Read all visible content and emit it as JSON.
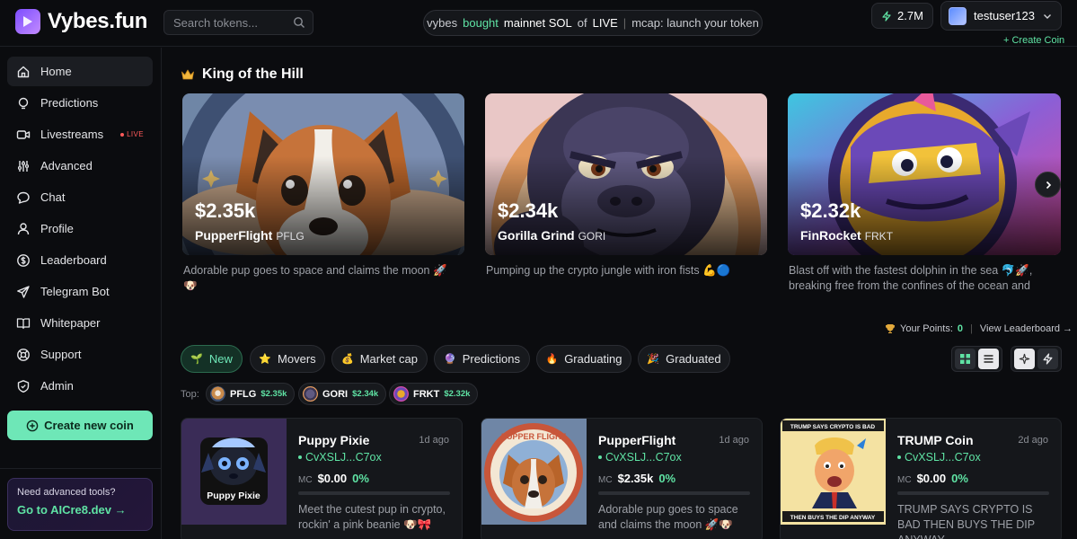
{
  "app": {
    "name": "Vybes.fun"
  },
  "search": {
    "placeholder": "Search tokens..."
  },
  "ticker": {
    "user": "vybes",
    "action": "bought",
    "network": "mainnet SOL",
    "of": "of",
    "status": "LIVE",
    "sep": "|",
    "mcap": "mcap: launch your token"
  },
  "header": {
    "points": "2.7M",
    "username": "testuser123",
    "create_link": "+ Create Coin"
  },
  "sidebar": {
    "items": [
      {
        "label": "Home",
        "icon": "home-icon",
        "active": true
      },
      {
        "label": "Predictions",
        "icon": "lightbulb-icon"
      },
      {
        "label": "Livestreams",
        "icon": "video-icon",
        "badge": "LIVE"
      },
      {
        "label": "Advanced",
        "icon": "sliders-icon"
      },
      {
        "label": "Chat",
        "icon": "chat-icon"
      },
      {
        "label": "Profile",
        "icon": "user-icon"
      },
      {
        "label": "Leaderboard",
        "icon": "dollar-circle-icon"
      },
      {
        "label": "Telegram Bot",
        "icon": "send-icon"
      },
      {
        "label": "Whitepaper",
        "icon": "book-icon"
      },
      {
        "label": "Support",
        "icon": "lifebuoy-icon"
      },
      {
        "label": "Admin",
        "icon": "shield-icon"
      }
    ],
    "create_button": "Create new coin",
    "promo": {
      "question": "Need advanced tools?",
      "link": "Go to AICre8.dev →"
    }
  },
  "king": {
    "title": "King of the Hill",
    "cards": [
      {
        "mc": "$2.35k",
        "name": "PupperFlight",
        "symbol": "PFLG",
        "desc": "Adorable pup goes to space and claims the moon 🚀🐶"
      },
      {
        "mc": "$2.34k",
        "name": "Gorilla Grind",
        "symbol": "GORI",
        "desc": "Pumping up the crypto jungle with iron fists 💪🔵"
      },
      {
        "mc": "$2.32k",
        "name": "FinRocket",
        "symbol": "FRKT",
        "desc": "Blast off with the fastest dolphin in the sea 🐬🚀, breaking free from the confines of the ocean and shattering…"
      }
    ]
  },
  "points_line": {
    "label": "Your Points:",
    "value": "0",
    "sep": "|",
    "link": "View Leaderboard →"
  },
  "filters": [
    {
      "label": "New",
      "icon": "sprout-icon",
      "active": true
    },
    {
      "label": "Movers",
      "icon": "star-icon"
    },
    {
      "label": "Market cap",
      "icon": "moneybag-icon"
    },
    {
      "label": "Predictions",
      "icon": "crystal-ball-icon"
    },
    {
      "label": "Graduating",
      "icon": "fire-icon"
    },
    {
      "label": "Graduated",
      "icon": "party-icon"
    }
  ],
  "top": {
    "label": "Top:",
    "chips": [
      {
        "symbol": "PFLG",
        "mc": "$2.35k",
        "color": "#c98a4b"
      },
      {
        "symbol": "GORI",
        "mc": "$2.34k",
        "color": "#5a4f86"
      },
      {
        "symbol": "FRKT",
        "mc": "$2.32k",
        "color": "#d64aa8"
      }
    ]
  },
  "coins": [
    {
      "name": "Puppy Pixie",
      "age": "1d ago",
      "address": "CvXSLJ...C7ox",
      "mc_label": "MC",
      "mc": "$0.00",
      "pct": "0%",
      "progress": 0,
      "desc": "Meet the cutest pup in crypto, rockin' a pink beanie 🐶🎀",
      "img_text": "Puppy Pixie"
    },
    {
      "name": "PupperFlight",
      "age": "1d ago",
      "address": "CvXSLJ...C7ox",
      "mc_label": "MC",
      "mc": "$2.35k",
      "pct": "0%",
      "progress": 0,
      "desc": "Adorable pup goes to space and claims the moon 🚀🐶",
      "img_text": "PUPPER FLIGHT"
    },
    {
      "name": "TRUMP Coin",
      "age": "2d ago",
      "address": "CvXSLJ...C7ox",
      "mc_label": "MC",
      "mc": "$0.00",
      "pct": "0%",
      "progress": 0,
      "desc": "TRUMP SAYS CRYPTO IS BAD THEN BUYS THE DIP ANYWAY",
      "img_top": "TRUMP SAYS CRYPTO IS BAD",
      "img_bottom": "THEN BUYS THE DIP ANYWAY"
    }
  ],
  "colors": {
    "accent": "#6ee7b7",
    "bg": "#0b0c0f",
    "panel": "#15171b",
    "live": "#ff5a5a"
  }
}
